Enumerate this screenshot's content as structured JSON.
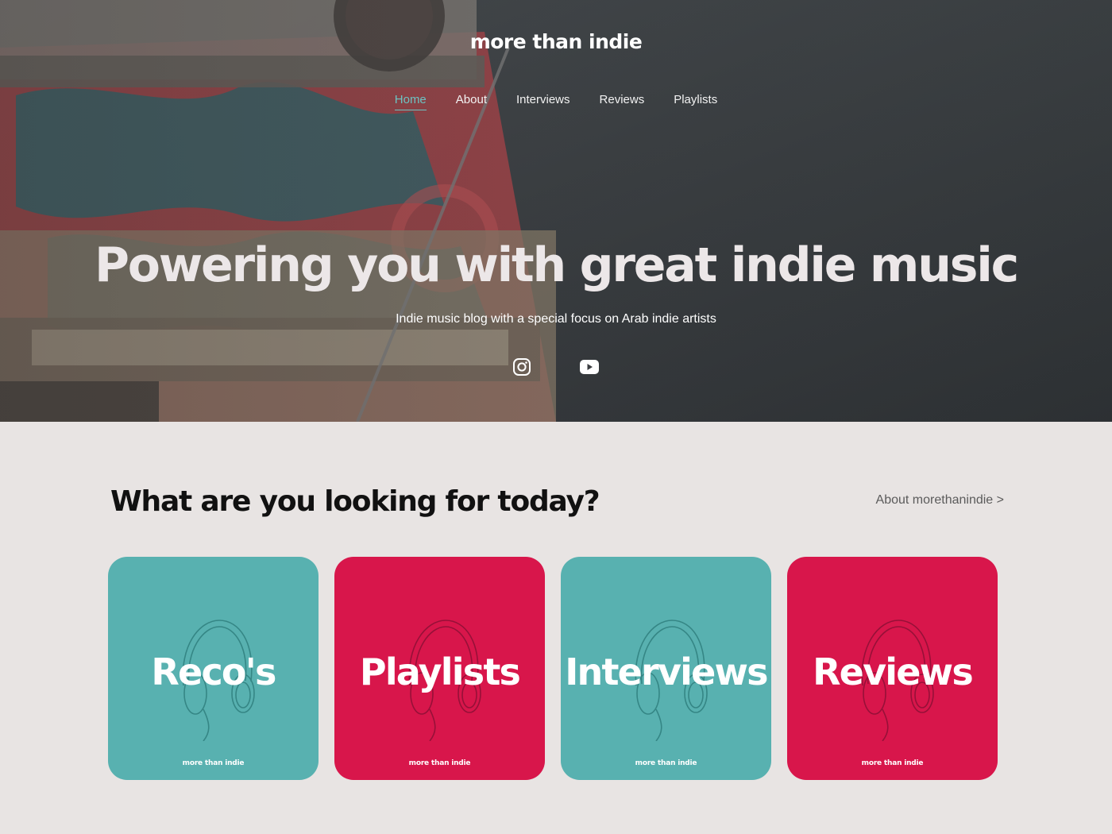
{
  "header": {
    "site_title": "more than indie",
    "nav": [
      {
        "label": "Home",
        "active": true
      },
      {
        "label": "About",
        "active": false
      },
      {
        "label": "Interviews",
        "active": false
      },
      {
        "label": "Reviews",
        "active": false
      },
      {
        "label": "Playlists",
        "active": false
      }
    ]
  },
  "hero": {
    "headline": "Powering you with great indie music",
    "subheadline": "Indie music blog with a special focus on Arab indie artists",
    "social": [
      {
        "icon": "instagram-icon"
      },
      {
        "icon": "youtube-icon"
      }
    ]
  },
  "main": {
    "section_title": "What are you looking for today?",
    "about_link": "About morethanindie >",
    "cards": [
      {
        "label": "Reco's",
        "brand": "more than indie",
        "color": "#58b1b0",
        "icon": "headphones-icon"
      },
      {
        "label": "Playlists",
        "brand": "more than indie",
        "color": "#d8164b",
        "icon": "headphones-icon"
      },
      {
        "label": "Interviews",
        "brand": "more than indie",
        "color": "#58b1b0",
        "icon": "headphones-icon"
      },
      {
        "label": "Reviews",
        "brand": "more than indie",
        "color": "#d8164b",
        "icon": "headphones-icon"
      }
    ]
  },
  "colors": {
    "accent": "#6cc3c2",
    "teal": "#58b1b0",
    "red": "#d8164b",
    "page_background": "#e8e4e3"
  }
}
